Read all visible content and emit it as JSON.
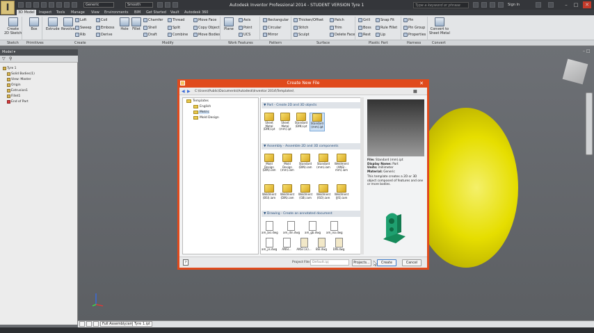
{
  "titlebar": {
    "app_logo": "I",
    "combo_material": "Generic",
    "combo_appearance": "Smooth",
    "window_title": "Autodesk Inventor Professional 2014 - STUDENT VERSION   Tyre 1",
    "help_search_placeholder": "Type a keyword or phrase",
    "sign_in": "Sign In"
  },
  "tabs": [
    "3D Model",
    "Inspect",
    "Tools",
    "Manage",
    "View",
    "Environments",
    "BIM",
    "Get Started",
    "Vault",
    "Autodesk 360"
  ],
  "ribbon": {
    "create_sketch": "Create\n2D Sketch",
    "box": "Box",
    "extrude": "Extrude",
    "revolve": "Revolve",
    "loft": "Loft",
    "coil": "Coil",
    "sweep": "Sweep",
    "emboss": "Emboss",
    "rib": "Rib",
    "derive": "Derive",
    "hole": "Hole",
    "fillet": "Fillet",
    "chamfer": "Chamfer",
    "thread": "Thread",
    "shell": "Shell",
    "split": "Split",
    "draft": "Draft",
    "combine": "Combine",
    "move_face": "Move Face",
    "copy_object": "Copy Object",
    "move_bodies": "Move Bodies",
    "plane": "Plane",
    "axis": "Axis",
    "point": "Point",
    "ucs": "UCS",
    "rectangular": "Rectangular",
    "circular": "Circular",
    "mirror": "Mirror",
    "thicken_offset": "Thicken/Offset",
    "stitch": "Stitch",
    "sculpt": "Sculpt",
    "patch": "Patch",
    "trim": "Trim",
    "delete_face": "Delete Face",
    "grill": "Grill",
    "snap_fit": "Snap Fit",
    "boss": "Boss",
    "rule_fillet": "Rule Fillet",
    "rest": "Rest",
    "lip": "Lip",
    "pin": "Pin",
    "pin_group": "Pin Group",
    "properties": "Properties",
    "convert": "Convert to\nSheet Metal"
  },
  "panels": [
    "Sketch",
    "Primitives",
    "Create",
    "Modify",
    "Work Features",
    "Pattern",
    "Surface",
    "Plastic Part",
    "Harness",
    "Convert"
  ],
  "browser": {
    "header": "Model",
    "tree": [
      "Tyre 1",
      "Solid Bodies(1)",
      "View: Master",
      "Origin",
      "Extrusion1",
      "Fillet1",
      "End of Part"
    ]
  },
  "dialog": {
    "title": "Create New File",
    "path": "C:\\Users\\Public\\Documents\\Autodesk\\Inventor 2014\\Templates\\",
    "folders": [
      "Templates",
      "English",
      "Metric",
      "Mold Design"
    ],
    "sections": [
      {
        "title": "Part - Create 2D and 3D objects"
      },
      {
        "title": "Assembly - Assemble 2D and 3D components"
      },
      {
        "title": "Drawing - Create an annotated document"
      }
    ],
    "part_items": [
      "Sheet Metal (DIN).ipt",
      "Sheet Metal (mm).ipt",
      "Standard (DIN).ipt",
      "Standard (mm).ipt"
    ],
    "assembly_items": [
      "Mold Design (DIN).iam",
      "Mold Design (mm).iam",
      "Standard (DIN).iam",
      "Standard (mm).iam",
      "Weldment (ANSI - mm).iam",
      "Weldment (BSI).iam",
      "Weldment (DIN).iam",
      "Weldment (GB).iam",
      "Weldment (ISO).iam",
      "Weldment (JIS).iam"
    ],
    "drawing_items": [
      "am_bsi.dwg",
      "am_din.dwg",
      "am_gb.dwg",
      "am_iso.dwg"
    ],
    "drawing_items_row2": [
      "am_jis.dwg",
      "ANSI...",
      "ANSI (in)...",
      "BSI.dwg",
      "DIN.dwg"
    ],
    "info": {
      "file_label": "File:",
      "file_value": "Standard (mm).ipt",
      "display_label": "Display Name:",
      "display_value": "Part",
      "units_label": "Units:",
      "units_value": "millimeter",
      "material_label": "Material:",
      "material_value": "Generic",
      "description": "This template creates a 2D or 3D object composed of features and one or more bodies."
    },
    "project_label": "Project File:",
    "project_value": "Default.ipj",
    "projects_button": "Projects...",
    "create_button": "Create",
    "cancel_button": "Cancel"
  },
  "statusbar": {
    "tab1": "Full Assembly.iam",
    "tab2": "Tyre 1.ipt"
  },
  "colors": {
    "dialog_frame": "#e04a1c",
    "torus": "#e6de00",
    "preview_model": "#1f9a6a"
  }
}
